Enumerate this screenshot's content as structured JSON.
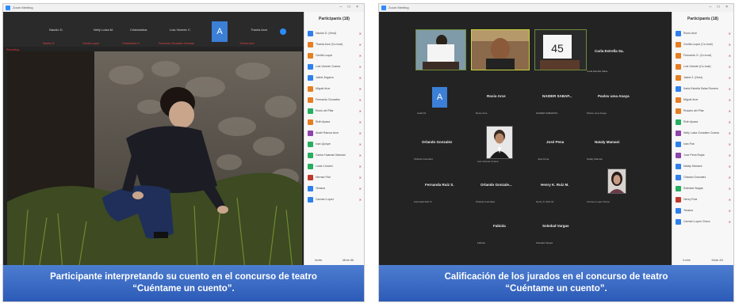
{
  "left": {
    "window_title": "Zoom Meeting",
    "window_controls": "– □ ×",
    "participants_title": "Participants (18)",
    "top_names": [
      "Nacido D.",
      "Nelly Luisa M.",
      "Cristobalina.",
      "Luis Vicente C.",
      "Thania Arce"
    ],
    "top_tile_letter": "A",
    "top_subs": [
      "Nacido D.",
      "Cecilia Luque",
      "Cristobalina S.",
      "Fernando Gonzales Cuentas",
      "Thania Arce"
    ],
    "recording_label": "Recording",
    "participants": [
      {
        "name": "Nacido D. (Host)",
        "color": "#2f80ed"
      },
      {
        "name": "Thania Arce (Co-host)",
        "color": "#e67e22"
      },
      {
        "name": "Cecilia Luque",
        "color": "#e67e22"
      },
      {
        "name": "Luis Vicente Ccama",
        "color": "#2f80ed"
      },
      {
        "name": "Jaime Zegarra",
        "color": "#2f80ed"
      },
      {
        "name": "Miguel Arce",
        "color": "#e67e22"
      },
      {
        "name": "Fernando Gonzales",
        "color": "#e67e22"
      },
      {
        "name": "Rocio del Pilar",
        "color": "#27ae60"
      },
      {
        "name": "Ruth Apaza",
        "color": "#e67e22"
      },
      {
        "name": "Anahi Ramos Arce",
        "color": "#8e44ad"
      },
      {
        "name": "Ivan Quispe",
        "color": "#27ae60"
      },
      {
        "name": "Carlos Huaman Mamani",
        "color": "#27ae60"
      },
      {
        "name": "Lucia Condori",
        "color": "#27ae60"
      },
      {
        "name": "Hernan Pari",
        "color": "#c0392b"
      },
      {
        "name": "Yessica",
        "color": "#2f80ed"
      },
      {
        "name": "Carmen Lopez",
        "color": "#2f80ed"
      }
    ],
    "footer": [
      "Invite",
      "Mute All"
    ],
    "caption_line1": "Participante interpretando su cuento en el concurso de teatro",
    "caption_line2": "“Cuéntame un cuento”."
  },
  "right": {
    "window_title": "Zoom Meeting",
    "window_controls": "– □ ×",
    "participants_title": "Participants (18)",
    "sign_number": "45",
    "cells": [
      {
        "name": "Carla Estrella Sa.",
        "sub": "Carla Estrella Salas"
      },
      {
        "name": "Rocio Arce",
        "sub": "Rocio Arce"
      },
      {
        "name": "NAIDER SABAP...",
        "sub": "NAIDER SABAPATA"
      },
      {
        "name": "Pavlov uma Anaya",
        "sub": "Pavlov uma Anaya"
      },
      {
        "name": "Orlando Gonzalez",
        "sub": "Orlando Gonzalez"
      },
      {
        "name": "José Pena",
        "sub": "José Pena"
      },
      {
        "name": "Nataly Mamani",
        "sub": "Nataly Mamani"
      },
      {
        "name": "Fernanda Ruiz S.",
        "sub": "Fernanda Ruiz S."
      },
      {
        "name": "Orlando Gonzale...",
        "sub": "Orlando Gonzales"
      },
      {
        "name": "Henry K. Ruiz M.",
        "sub": "Henry K. Ruiz M."
      },
      {
        "name": "Fabiola",
        "sub": "Fabiola"
      },
      {
        "name": "Soledad Vargas",
        "sub": "Soledad Vargas"
      }
    ],
    "tile_letter": "A",
    "tile_sub": "Anahi M.",
    "photo_subs": [
      "Luis Vicente Ccama",
      "Carmen Lopez Chura"
    ],
    "participants": [
      {
        "name": "Rocio Arce",
        "color": "#2f80ed"
      },
      {
        "name": "Cecilia Luque (Co-host)",
        "color": "#e67e22"
      },
      {
        "name": "Fernando G. (Co-host)",
        "color": "#e67e22"
      },
      {
        "name": "Luis Vicente (Co-host)",
        "color": "#e67e22"
      },
      {
        "name": "Jaime Z. (Host)",
        "color": "#e67e22"
      },
      {
        "name": "Karla Estrella Salas Romero",
        "color": "#2f80ed"
      },
      {
        "name": "Miguel Arce",
        "color": "#e67e22"
      },
      {
        "name": "Rosario del Pilar",
        "color": "#e67e22"
      },
      {
        "name": "Ruth Apaza",
        "color": "#27ae60"
      },
      {
        "name": "Nelly Luisa Gonzalez Ccama",
        "color": "#8e44ad"
      },
      {
        "name": "Ivan Pari",
        "color": "#2f80ed"
      },
      {
        "name": "Jose Pena Rojas",
        "color": "#8e44ad"
      },
      {
        "name": "Nataly Mamani",
        "color": "#2f80ed"
      },
      {
        "name": "Orlando Gonzalez",
        "color": "#2f80ed"
      },
      {
        "name": "Soledad Vargas",
        "color": "#27ae60"
      },
      {
        "name": "Henry Ruiz",
        "color": "#c0392b"
      },
      {
        "name": "Yessica",
        "color": "#2f80ed"
      },
      {
        "name": "Carmen Lopez Chura",
        "color": "#2f80ed"
      }
    ],
    "footer": [
      "Invite",
      "Mute All"
    ],
    "caption_line1": "Calificación de los jurados en el concurso de teatro",
    "caption_line2": "“Cuéntame un cuento”."
  }
}
